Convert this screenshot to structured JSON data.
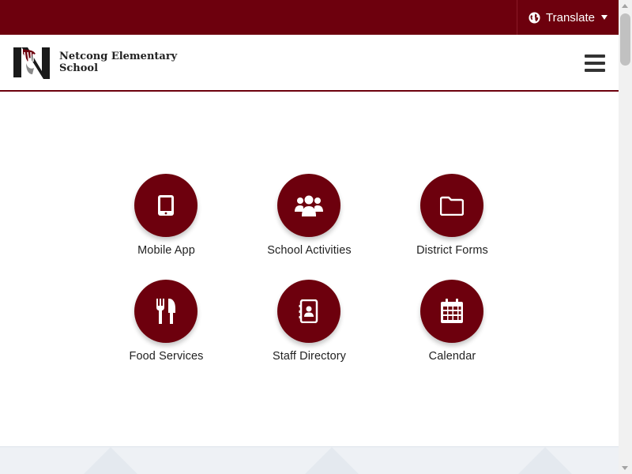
{
  "topbar": {
    "translate_label": "Translate",
    "translate_icon": "globe-icon",
    "background_color": "#6d000d"
  },
  "header": {
    "school_name": "Netcong Elementary School",
    "logo_icon": "school-logo-icon",
    "menu_icon": "hamburger-menu-icon"
  },
  "quick_links": [
    {
      "label": "Mobile App",
      "icon": "tablet-icon"
    },
    {
      "label": "School Activities",
      "icon": "users-icon"
    },
    {
      "label": "District Forms",
      "icon": "folder-icon"
    },
    {
      "label": "Food Services",
      "icon": "utensils-icon"
    },
    {
      "label": "Staff Directory",
      "icon": "address-book-icon"
    },
    {
      "label": "Calendar",
      "icon": "calendar-icon"
    }
  ],
  "theme": {
    "accent": "#6d000d",
    "footer_band": "#eef1f5"
  }
}
